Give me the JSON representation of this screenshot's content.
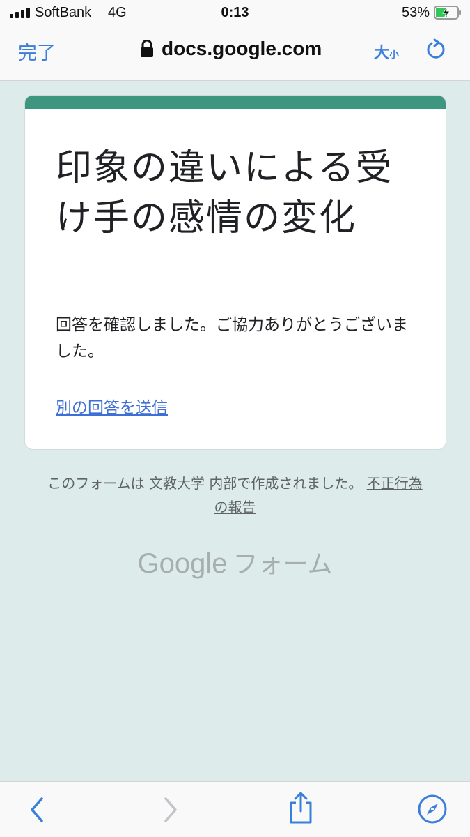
{
  "status_bar": {
    "carrier": "SoftBank",
    "network": "4G",
    "time": "0:13",
    "battery_percent": "53%"
  },
  "browser": {
    "done_label": "完了",
    "url": "docs.google.com",
    "text_size_large": "大",
    "text_size_small": "小"
  },
  "form": {
    "title": "印象の違いによる受け手の感情の変化",
    "confirmation": "回答を確認しました。ご協力ありがとうございました。",
    "another_response_link": "別の回答を送信"
  },
  "footer": {
    "note": "このフォームは 文教大学 内部で作成されました。",
    "report_abuse": "不正行為の報告",
    "logo_google": "Google",
    "logo_forms": "フォーム"
  },
  "colors": {
    "accent": "#3f9680",
    "background": "#ddecea",
    "link": "#3e6fd4",
    "ios_blue": "#3a7fdc"
  },
  "icons": {
    "back": "chevron-left-icon",
    "forward": "chevron-right-icon",
    "share": "share-icon",
    "safari": "compass-icon",
    "reload": "reload-icon",
    "lock": "lock-icon"
  }
}
